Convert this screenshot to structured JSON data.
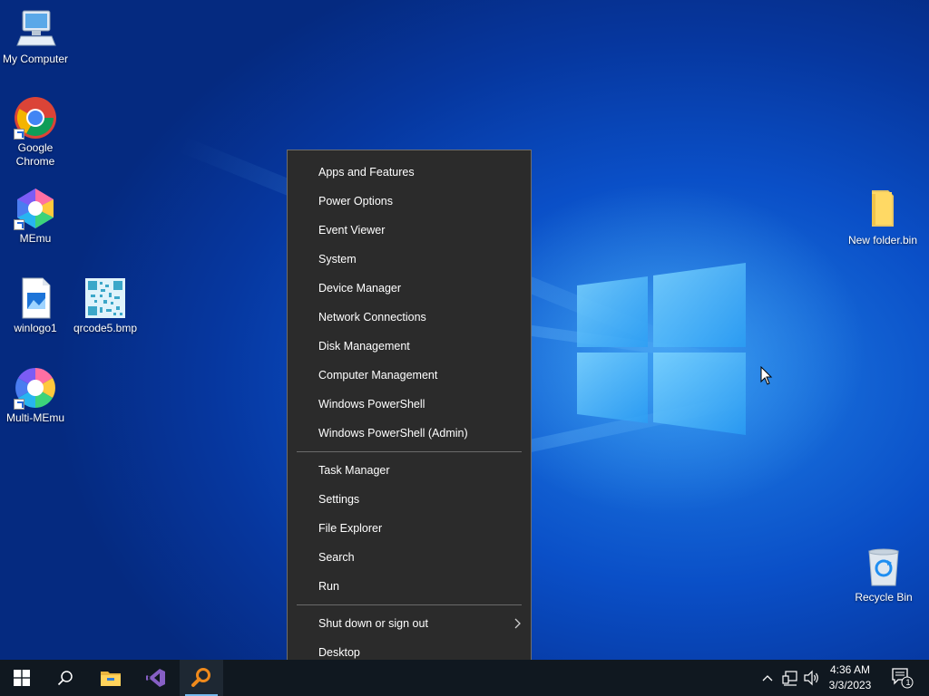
{
  "desktop": {
    "icons": {
      "my_computer": "My Computer",
      "chrome": "Google Chrome",
      "memu": "MEmu",
      "winlogo1": "winlogo1",
      "qrcode": "qrcode5.bmp",
      "multi_memu": "Multi-MEmu",
      "new_folder": "New folder.bin",
      "recycle_bin": "Recycle Bin"
    }
  },
  "context_menu": {
    "group1": [
      "Apps and Features",
      "Power Options",
      "Event Viewer",
      "System",
      "Device Manager",
      "Network Connections",
      "Disk Management",
      "Computer Management",
      "Windows PowerShell",
      "Windows PowerShell (Admin)"
    ],
    "group2": [
      "Task Manager",
      "Settings",
      "File Explorer",
      "Search",
      "Run"
    ],
    "shutdown": "Shut down or sign out",
    "desktop": "Desktop"
  },
  "taskbar": {
    "apps": [
      "start-icon",
      "search-icon",
      "file-explorer-icon",
      "visual-studio-icon",
      "magnifier-search-app-icon"
    ],
    "tray": [
      "chevron-up-icon",
      "network-icon",
      "volume-icon"
    ],
    "time": "4:36 AM",
    "date": "3/3/2023",
    "notification_count": "1"
  },
  "colors": {
    "menu_bg": "#2b2b2b",
    "taskbar_bg": "#101820",
    "desktop_accent": "#0a4fc7",
    "active_indicator": "#76b9ed"
  }
}
